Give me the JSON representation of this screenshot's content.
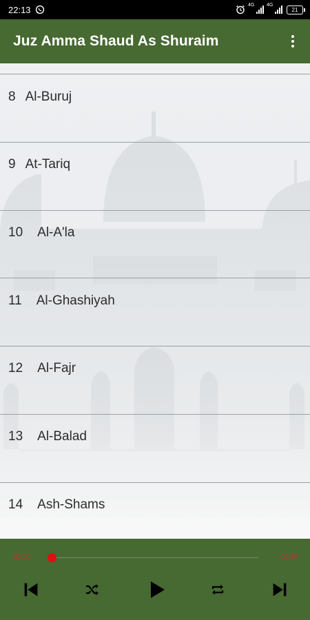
{
  "status_bar": {
    "time": "22:13",
    "network_label_1": "4G",
    "network_label_2": "4G",
    "battery_level": "21"
  },
  "app_bar": {
    "title": "Juz Amma Shaud As Shuraim"
  },
  "surah_list": [
    {
      "number": "8",
      "name": "Al-Buruj"
    },
    {
      "number": "9",
      "name": "At-Tariq"
    },
    {
      "number": "10",
      "name": "Al-A'la"
    },
    {
      "number": "11",
      "name": "Al-Ghashiyah"
    },
    {
      "number": "12",
      "name": "Al-Fajr"
    },
    {
      "number": "13",
      "name": "Al-Balad"
    },
    {
      "number": "14",
      "name": "Ash-Shams"
    }
  ],
  "player": {
    "current_time": "00:00",
    "total_time": "00:00",
    "progress": 0
  },
  "controls": [
    "skip-previous-icon",
    "shuffle-icon",
    "play-icon",
    "repeat-icon",
    "skip-next-icon"
  ],
  "colors": {
    "app_bar": "#476932",
    "player_bar": "#476932",
    "seek_thumb": "#e01010",
    "time_text": "#d22a2a",
    "divider": "#9aa0a3"
  }
}
